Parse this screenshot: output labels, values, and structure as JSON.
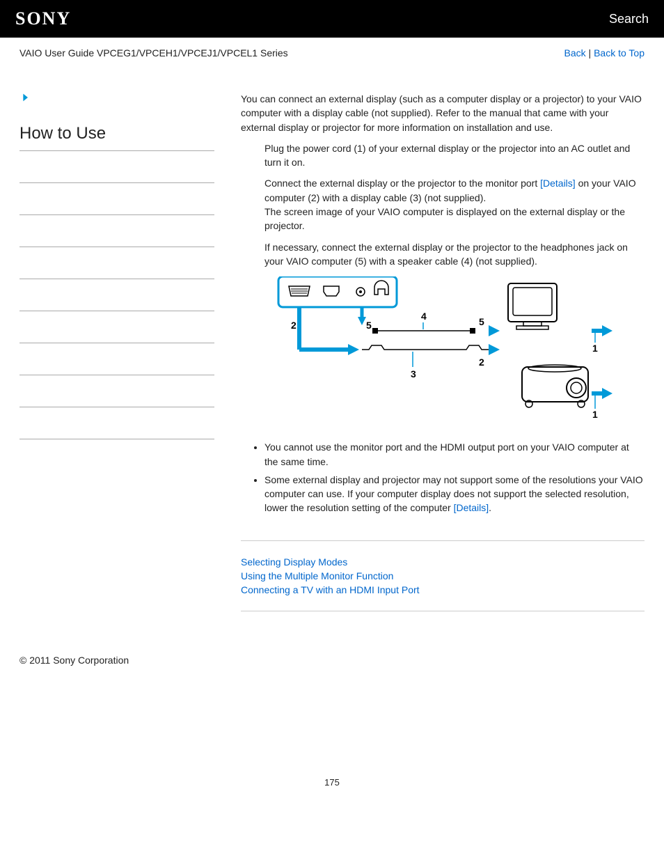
{
  "header": {
    "logo": "SONY",
    "search": "Search"
  },
  "breadcrumb": {
    "title": "VAIO User Guide VPCEG1/VPCEH1/VPCEJ1/VPCEL1 Series",
    "back": "Back",
    "sep": " | ",
    "top": "Back to Top"
  },
  "sidebar": {
    "title": "How to Use"
  },
  "main": {
    "intro": "You can connect an external display (such as a computer display or a projector) to your VAIO computer with a display cable (not supplied). Refer to the manual that came with your external display or projector for more information on installation and use.",
    "step1": "Plug the power cord (1) of your external display or the projector into an AC outlet and turn it on.",
    "step2a": "Connect the external display or the projector to the monitor port ",
    "step2_link": "[Details]",
    "step2b": " on your VAIO computer (2) with a display cable (3) (not supplied).",
    "step2c": "The screen image of your VAIO computer is displayed on the external display or the projector.",
    "step3": "If necessary, connect the external display or the projector to the headphones jack on your VAIO computer (5) with a speaker cable (4) (not supplied).",
    "note1": "You cannot use the monitor port and the HDMI output port on your VAIO computer at the same time.",
    "note2a": "Some external display and projector may not support some of the resolutions your VAIO computer can use. If your computer display does not support the selected resolution, lower the resolution setting of the computer ",
    "note2_link": "[Details]",
    "note2b": ".",
    "related1": "Selecting Display Modes",
    "related2": "Using the Multiple Monitor Function",
    "related3": "Connecting a TV with an HDMI Input Port"
  },
  "footer": {
    "copyright": "© 2011 Sony Corporation",
    "page": "175"
  },
  "diagram_labels": {
    "l1": "1",
    "l2": "2",
    "l3": "3",
    "l4": "4",
    "l5": "5"
  }
}
